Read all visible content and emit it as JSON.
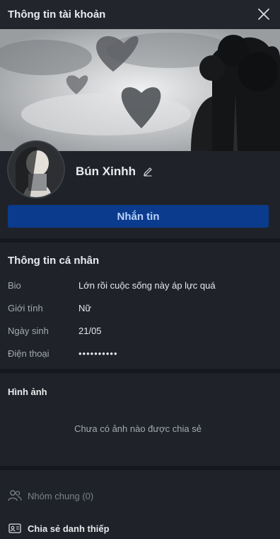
{
  "header": {
    "title": "Thông tin tài khoản",
    "close_icon": "close-icon"
  },
  "profile": {
    "name": "Bún Xinhh",
    "edit_icon": "pencil-icon"
  },
  "actions": {
    "message_label": "Nhắn tin"
  },
  "personal_info": {
    "title": "Thông tin cá nhân",
    "rows": [
      {
        "label": "Bio",
        "value": "Lớn rồi cuộc sống này áp lực quá"
      },
      {
        "label": "Giới tính",
        "value": "Nữ"
      },
      {
        "label": "Ngày sinh",
        "value": "21/05"
      },
      {
        "label": "Điện thoại",
        "value": "••••••••••"
      }
    ]
  },
  "photos": {
    "title": "Hình ảnh",
    "empty_text": "Chưa có ảnh nào được chia sẻ"
  },
  "footer": {
    "groups_label": "Nhóm chung (0)",
    "share_label": "Chia sẻ danh thiếp"
  },
  "colors": {
    "background": "#1f2329",
    "button": "#0b3b8c",
    "button_text": "#b9d2ff"
  }
}
